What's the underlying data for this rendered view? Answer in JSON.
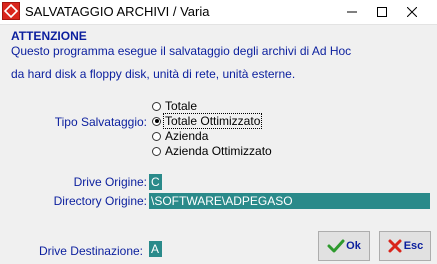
{
  "window": {
    "title": "SALVATAGGIO ARCHIVI / Varia"
  },
  "message": {
    "heading": "ATTENZIONE",
    "line1": "Questo programma esegue il salvataggio degli archivi di Ad Hoc",
    "line2": "da hard disk a floppy disk, unità di rete, unità esterne."
  },
  "backup_type": {
    "label": "Tipo Salvataggio:",
    "options": [
      "Totale",
      "Totale Ottimizzato",
      "Azienda",
      "Azienda Ottimizzato"
    ],
    "selected": "Totale Ottimizzato"
  },
  "source_drive": {
    "label": "Drive Origine:",
    "value": "C"
  },
  "source_directory": {
    "label": "Directory Origine:",
    "value": "\\SOFTWARE\\ADPEGASO"
  },
  "destination_drive": {
    "label": "Drive Destinazione:",
    "value": "A"
  },
  "buttons": {
    "ok": "Ok",
    "cancel": "Esc"
  },
  "colors": {
    "label_text": "#0b1f9e",
    "field_bg": "#2a8a8a",
    "app_icon": "#d9251c"
  }
}
